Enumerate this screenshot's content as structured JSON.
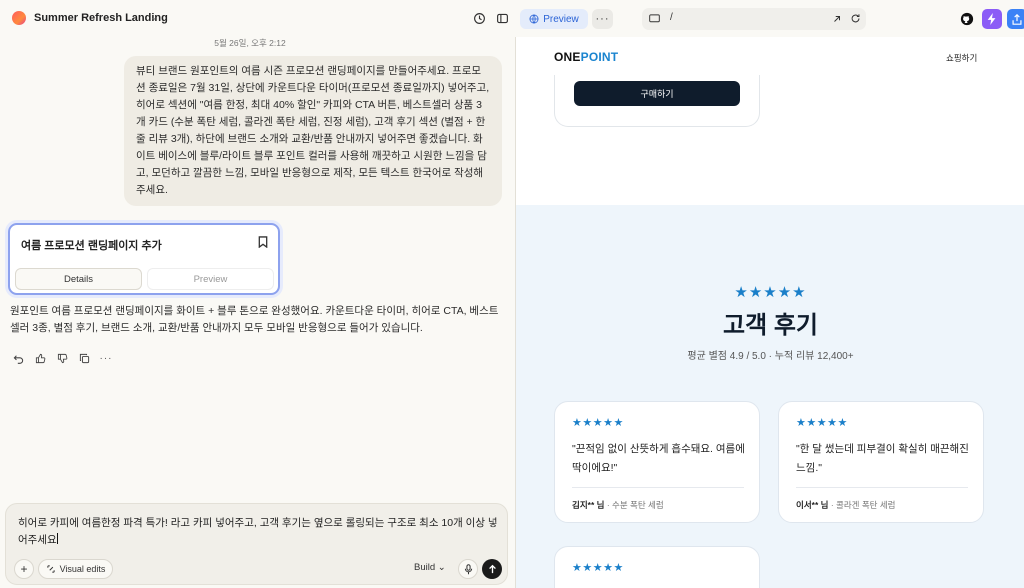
{
  "topbar": {
    "project_title": "Summer Refresh Landing",
    "preview_label": "Preview",
    "url_path": "/"
  },
  "chat": {
    "timestamp": "5월 26일, 오후 2:12",
    "user_message": "뷰티 브랜드 원포인트의 여름 시즌 프로모션 랜딩페이지를 만들어주세요. 프로모션 종료일은 7월 31일, 상단에 카운트다운 타이머(프로모션 종료일까지) 넣어주고, 히어로 섹션에 \"여름 한정, 최대 40% 할인\" 카피와 CTA 버튼, 베스트셀러 상품 3개 카드 (수분 폭탄 세럼, 콜라겐 폭탄 세럼, 진정 세럼), 고객 후기 섹션 (별점 + 한 줄 리뷰 3개), 하단에 브랜드 소개와 교환/반품 안내까지 넣어주면 좋겠습니다. 화이트 베이스에 블루/라이트 블루 포인트 컬러를 사용해 깨끗하고 시원한 느낌을 담고, 모던하고 깔끔한 느낌, 모바일 반응형으로 제작, 모든 텍스트 한국어로 작성해주세요.",
    "card": {
      "title": "여름 프로모션 랜딩페이지 추가",
      "tab_details": "Details",
      "tab_preview": "Preview"
    },
    "assistant_message": "원포인트 여름 프로모션 랜딩페이지를 화이트 + 블루 톤으로 완성했어요. 카운트다운 타이머, 히어로 CTA, 베스트셀러 3종, 별점 후기, 브랜드 소개, 교환/반품 안내까지 모두 모바일 반응형으로 들어가 있습니다."
  },
  "composer": {
    "input_text": "히어로 카피에 여름한정 파격 특가! 라고 카피 넣어주고, 고객 후기는 옆으로 롤링되는 구조로 최소 10개 이상 넣어주세요",
    "visual_edits_label": "Visual edits",
    "mode_label": "Build"
  },
  "preview": {
    "brand_one": "ONE",
    "brand_point": "POINT",
    "shop_link": "쇼핑하기",
    "buy_button": "구매하기",
    "reviews": {
      "stars": "★★★★★",
      "title": "고객 후기",
      "subtitle": "평균 별점 4.9 / 5.0 · 누적 리뷰 12,400+",
      "items": [
        {
          "stars": "★★★★★",
          "quote": "\"끈적임 없이 산뜻하게 흡수돼요. 여름에 딱이에요!\"",
          "author": "김지** 님",
          "sep": " · ",
          "product": "수분 폭탄 세럼"
        },
        {
          "stars": "★★★★★",
          "quote": "\"한 달 썼는데 피부결이 확실히 매끈해진 느낌.\"",
          "author": "이서** 님",
          "sep": " · ",
          "product": "콜라겐 폭탄 세럼"
        },
        {
          "stars": "★★★★★"
        }
      ]
    }
  },
  "colors": {
    "accent_blue": "#1a7fc9",
    "preview_pill": "#2a63d6",
    "bolt_purple": "#8b5cf6",
    "share_blue": "#3b82f6",
    "dark_navy": "#0f1c2c"
  }
}
